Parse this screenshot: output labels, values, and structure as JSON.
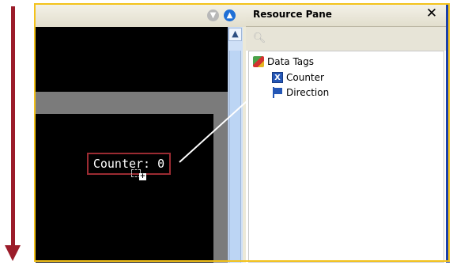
{
  "canvas": {
    "widget_text": "Counter: 0",
    "toolbar_down_icon": "circle-down-icon",
    "toolbar_up_icon": "circle-up-icon"
  },
  "resource_pane": {
    "title": "Resource Pane",
    "close_icon": "close-icon",
    "search_icon": "search-icon",
    "tree": {
      "root_label": "Data Tags",
      "items": [
        {
          "label": "Counter",
          "icon": "counter-tag-icon"
        },
        {
          "label": "Direction",
          "icon": "direction-flag-icon"
        }
      ]
    }
  },
  "colors": {
    "arrow": "#9b1c2a",
    "frame": "#f3c21b",
    "widget_border": "#9b2b32"
  }
}
